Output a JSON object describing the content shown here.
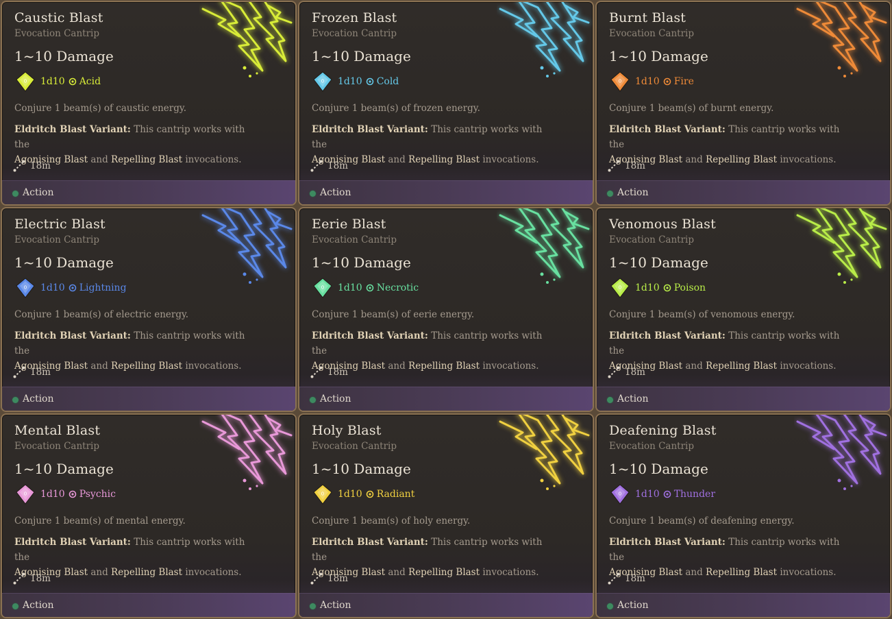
{
  "cards": [
    {
      "title": "Caustic Blast",
      "school": "Evocation Cantrip",
      "damage": "1~10 Damage",
      "dice": "1d10",
      "damage_type": "Acid",
      "icon": "acid-icon",
      "description": "Conjure 1 beam(s) of caustic energy.",
      "variant_title": "Eldritch Blast Variant:",
      "variant_text": "This cantrip works with the",
      "invocation_a": "Agonising Blast",
      "and_word": "and",
      "invocation_b": "Repelling Blast",
      "invocations_word": "invocations.",
      "range": "18m",
      "action": "Action",
      "color": "#d8ec38"
    },
    {
      "title": "Frozen Blast",
      "school": "Evocation Cantrip",
      "damage": "1~10 Damage",
      "dice": "1d10",
      "damage_type": "Cold",
      "icon": "snowflake-icon",
      "description": "Conjure 1 beam(s) of frozen energy.",
      "variant_title": "Eldritch Blast Variant:",
      "variant_text": "This cantrip works with the",
      "invocation_a": "Agonising Blast",
      "and_word": "and",
      "invocation_b": "Repelling Blast",
      "invocations_word": "invocations.",
      "range": "18m",
      "action": "Action",
      "color": "#64c8e8"
    },
    {
      "title": "Burnt Blast",
      "school": "Evocation Cantrip",
      "damage": "1~10 Damage",
      "dice": "1d10",
      "damage_type": "Fire",
      "icon": "flame-icon",
      "description": "Conjure 1 beam(s) of burnt energy.",
      "variant_title": "Eldritch Blast Variant:",
      "variant_text": "This cantrip works with the",
      "invocation_a": "Agonising Blast",
      "and_word": "and",
      "invocation_b": "Repelling Blast",
      "invocations_word": "invocations.",
      "range": "18m",
      "action": "Action",
      "color": "#ee8a38"
    },
    {
      "title": "Electric Blast",
      "school": "Evocation Cantrip",
      "damage": "1~10 Damage",
      "dice": "1d10",
      "damage_type": "Lightning",
      "icon": "lightning-icon",
      "description": "Conjure 1 beam(s) of electric energy.",
      "variant_title": "Eldritch Blast Variant:",
      "variant_text": "This cantrip works with the",
      "invocation_a": "Agonising Blast",
      "and_word": "and",
      "invocation_b": "Repelling Blast",
      "invocations_word": "invocations.",
      "range": "18m",
      "action": "Action",
      "color": "#5a88e8"
    },
    {
      "title": "Eerie Blast",
      "school": "Evocation Cantrip",
      "damage": "1~10 Damage",
      "dice": "1d10",
      "damage_type": "Necrotic",
      "icon": "necrotic-icon",
      "description": "Conjure 1 beam(s) of eerie energy.",
      "variant_title": "Eldritch Blast Variant:",
      "variant_text": "This cantrip works with the",
      "invocation_a": "Agonising Blast",
      "and_word": "and",
      "invocation_b": "Repelling Blast",
      "invocations_word": "invocations.",
      "range": "18m",
      "action": "Action",
      "color": "#68e0a0"
    },
    {
      "title": "Venomous Blast",
      "school": "Evocation Cantrip",
      "damage": "1~10 Damage",
      "dice": "1d10",
      "damage_type": "Poison",
      "icon": "poison-icon",
      "description": "Conjure 1 beam(s) of venomous energy.",
      "variant_title": "Eldritch Blast Variant:",
      "variant_text": "This cantrip works with the",
      "invocation_a": "Agonising Blast",
      "and_word": "and",
      "invocation_b": "Repelling Blast",
      "invocations_word": "invocations.",
      "range": "18m",
      "action": "Action",
      "color": "#b8ec48"
    },
    {
      "title": "Mental Blast",
      "school": "Evocation Cantrip",
      "damage": "1~10 Damage",
      "dice": "1d10",
      "damage_type": "Psychic",
      "icon": "psychic-icon",
      "description": "Conjure 1 beam(s) of mental energy.",
      "variant_title": "Eldritch Blast Variant:",
      "variant_text": "This cantrip works with the",
      "invocation_a": "Agonising Blast",
      "and_word": "and",
      "invocation_b": "Repelling Blast",
      "invocations_word": "invocations.",
      "range": "18m",
      "action": "Action",
      "color": "#e898d8"
    },
    {
      "title": "Holy Blast",
      "school": "Evocation Cantrip",
      "damage": "1~10 Damage",
      "dice": "1d10",
      "damage_type": "Radiant",
      "icon": "radiant-icon",
      "description": "Conjure 1 beam(s) of holy energy.",
      "variant_title": "Eldritch Blast Variant:",
      "variant_text": "This cantrip works with the",
      "invocation_a": "Agonising Blast",
      "and_word": "and",
      "invocation_b": "Repelling Blast",
      "invocations_word": "invocations.",
      "range": "18m",
      "action": "Action",
      "color": "#f0d040"
    },
    {
      "title": "Deafening Blast",
      "school": "Evocation Cantrip",
      "damage": "1~10 Damage",
      "dice": "1d10",
      "damage_type": "Thunder",
      "icon": "thunder-icon",
      "description": "Conjure 1 beam(s) of deafening energy.",
      "variant_title": "Eldritch Blast Variant:",
      "variant_text": "This cantrip works with the",
      "invocation_a": "Agonising Blast",
      "and_word": "and",
      "invocation_b": "Repelling Blast",
      "invocations_word": "invocations.",
      "range": "18m",
      "action": "Action",
      "color": "#a070e0"
    }
  ]
}
